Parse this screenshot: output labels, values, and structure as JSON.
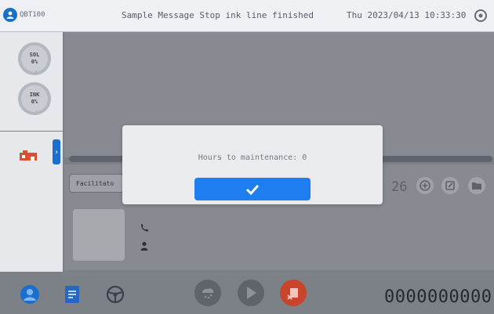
{
  "header": {
    "brand": "QBT100",
    "message": "Sample Message Stop ink line finished",
    "datetime": "Thu 2023/04/13 10:33:30"
  },
  "gauges": [
    {
      "label": "SOL",
      "value": "0%"
    },
    {
      "label": "INK",
      "value": "0%"
    }
  ],
  "job": {
    "field_value": "Facilitato",
    "count": "26"
  },
  "footer": {
    "counter": "0000000000"
  },
  "dialog": {
    "message": "Hours to maintenance: 0"
  },
  "colors": {
    "accent": "#1e7ef0",
    "stop_red": "#d8502f",
    "brand_blue": "#1a6fc7"
  },
  "icons": [
    "user-icon",
    "settings-icon",
    "alert-printer-icon",
    "chevron-right-icon",
    "plus-icon",
    "edit-icon",
    "folder-icon",
    "phone-icon",
    "person-icon",
    "user-circle-icon",
    "document-icon",
    "steering-icon",
    "nozzle-icon",
    "play-icon",
    "stop-print-icon",
    "check-icon"
  ]
}
